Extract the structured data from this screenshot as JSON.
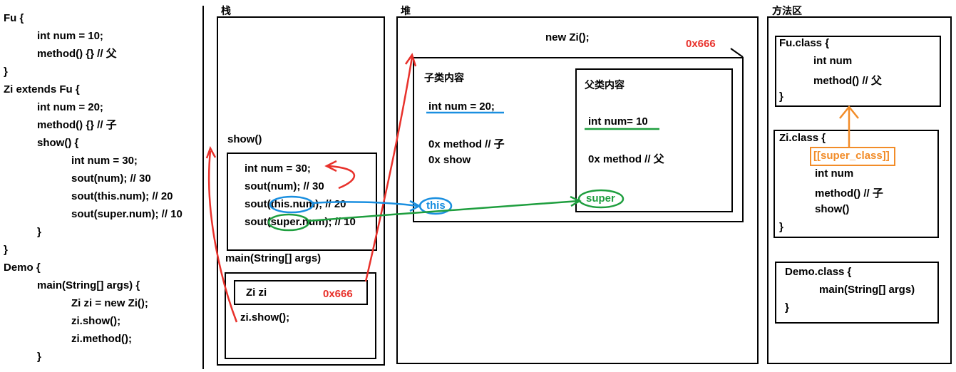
{
  "left_code": [
    "Fu {",
    "int num = 10;",
    "method() {} // 父",
    "}",
    "Zi extends Fu {",
    "int num = 20;",
    "method() {} // 子",
    "show() {",
    "int num = 30;",
    "sout(num); // 30",
    "sout(this.num); // 20",
    "sout(super.num); // 10",
    "}",
    "}",
    "Demo {",
    "main(String[] args) {",
    "Zi zi = new Zi();",
    "zi.show();",
    "zi.method();",
    "}"
  ],
  "stack": {
    "title": "栈",
    "show_label": "show()",
    "show_frame": [
      "int num = 30;",
      "sout(num); // 30",
      "sout(this.num); // 20",
      "sout(super.num); // 10"
    ],
    "main_label": "main(String[] args)",
    "main_var": "Zi zi",
    "main_addr": "0x666",
    "main_call": "zi.show();"
  },
  "heap": {
    "title": "堆",
    "new_label": "new Zi();",
    "addr": "0x666",
    "child_title": "子类内容",
    "child_num": "int num = 20;",
    "child_method": "0x method // 子",
    "child_show": "0x show",
    "parent_title": "父类内容",
    "parent_num": "int num= 10",
    "parent_method": "0x method // 父",
    "this_label": "this",
    "super_label": "super"
  },
  "method_area": {
    "title": "方法区",
    "fu_class": [
      "Fu.class {",
      "int num",
      "method() // 父",
      "}"
    ],
    "zi_class_head": "Zi.class {",
    "super_class": "[[super_class]]",
    "zi_class_body": [
      "int num",
      "method() // 子",
      "show()",
      "}"
    ],
    "demo_class": [
      "Demo.class {",
      "main(String[] args)",
      "}"
    ]
  },
  "colors": {
    "red": "#e8312b",
    "blue": "#1a8fe0",
    "green": "#1e9e3e",
    "orange": "#f28c28"
  }
}
